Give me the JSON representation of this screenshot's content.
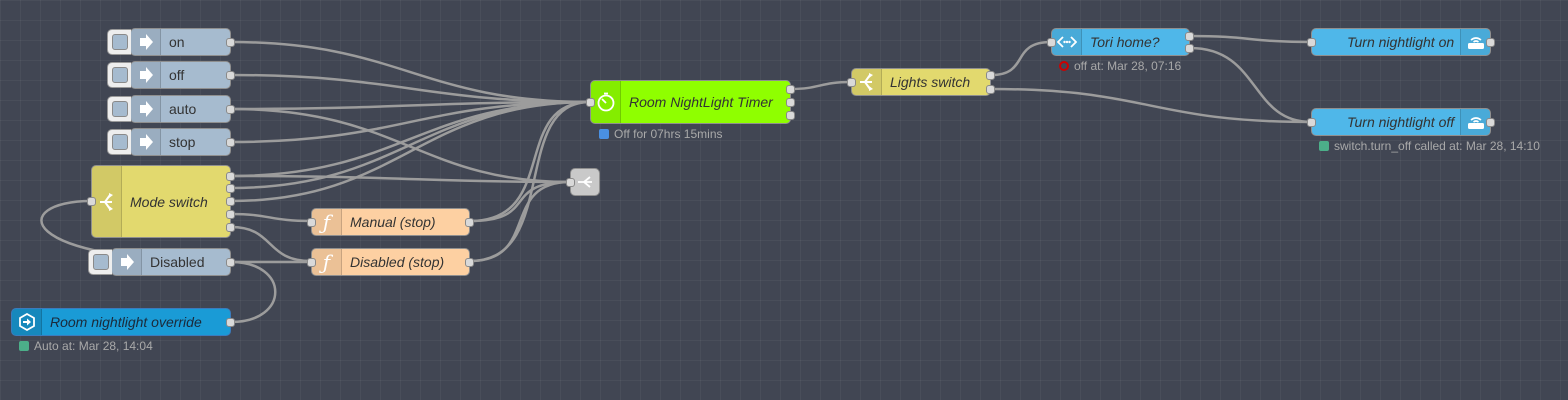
{
  "flow": {
    "inject_nodes": [
      {
        "id": "on",
        "label": "on"
      },
      {
        "id": "off",
        "label": "off"
      },
      {
        "id": "auto",
        "label": "auto"
      },
      {
        "id": "stop",
        "label": "stop"
      },
      {
        "id": "disabled",
        "label": "Disabled"
      }
    ],
    "mode_switch": {
      "label": "Mode switch"
    },
    "override": {
      "label": "Room nightlight override",
      "status": "Auto at: Mar 28, 14:04",
      "status_color": "#4caf89"
    },
    "manual_stop": {
      "label": "Manual (stop)"
    },
    "disabled_stop": {
      "label": "Disabled (stop)"
    },
    "timer": {
      "label": "Room NightLight Timer",
      "status": "Off for 07hrs 15mins",
      "status_color": "#4a90e2"
    },
    "lights_switch": {
      "label": "Lights switch"
    },
    "tori_home": {
      "label": "Tori home?",
      "status": "off at: Mar 28, 07:16",
      "status_color": "#cc0000"
    },
    "turn_on": {
      "label": "Turn nightlight on"
    },
    "turn_off": {
      "label": "Turn nightlight off",
      "status": "switch.turn_off called at: Mar 28, 14:10",
      "status_color": "#4caf89"
    }
  },
  "icons": {
    "inject": "arrow-right-icon",
    "switch": "switch-branch-icon",
    "function": "function-icon",
    "timer": "timer-icon",
    "junction": "link-junction-icon",
    "current_state": "state-check-icon",
    "service": "router-icon",
    "override": "override-arrow-icon"
  },
  "colors": {
    "canvas": "#414653",
    "inject": "#a6bbcf",
    "switch": "#e2d96e",
    "function": "#fdd0a2",
    "home_assistant": "#4fb7e9",
    "timer": "#8fff00",
    "wire": "#9a9a9a"
  }
}
